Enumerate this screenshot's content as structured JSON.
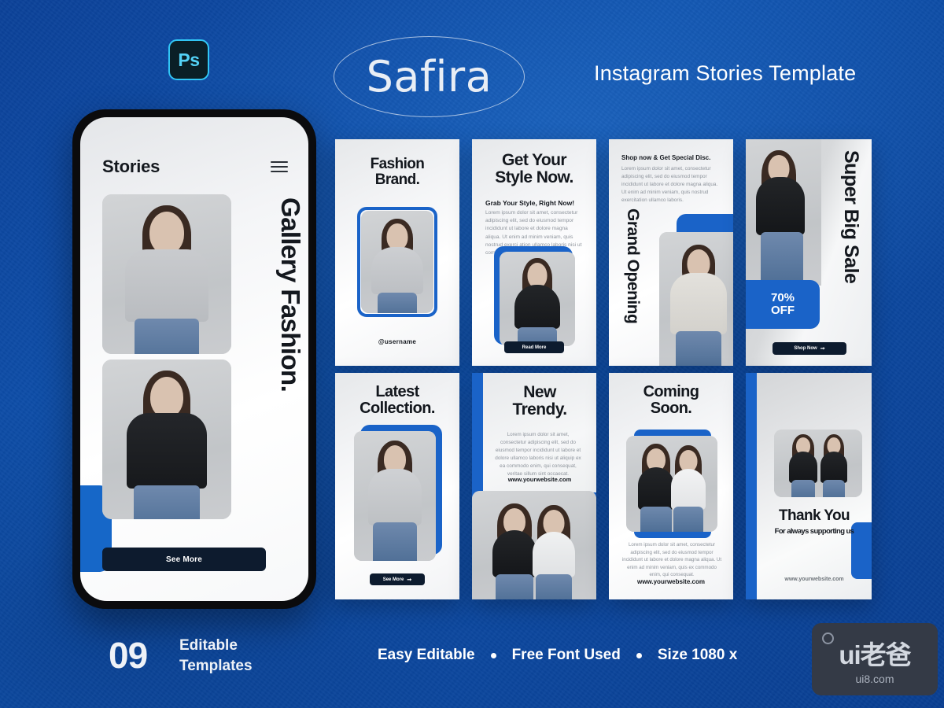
{
  "header": {
    "ps_badge": "Ps",
    "logo": "Safira",
    "tagline": "Instagram Stories Template"
  },
  "phone": {
    "title": "Stories",
    "menu_icon": "hamburger-icon",
    "vertical_title": "Gallery Fashion.",
    "button": "See More"
  },
  "cards": [
    {
      "id": "fashion-brand",
      "title": "Fashion\nBrand.",
      "username": "@username"
    },
    {
      "id": "get-your-style",
      "title": "Get Your\nStyle Now.",
      "subtitle": "Grab Your Style, Right Now!",
      "body": "Lorem ipsum dolor sit amet, consectetur adipiscing elit, sed do eiusmod tempor incididunt ut labore et dolore magna aliqua. Ut enim ad minim veniam, quis nostrud exerci ation ullamco laboris nisi ut commodo.",
      "button": "Read More"
    },
    {
      "id": "grand-opening",
      "heading": "Shop now & Get Special Disc.",
      "body": "Lorem ipsum dolor sit amet, consectetur adipiscing elit, sed do eiusmod tempor incididunt ut labore et dolore magna aliqua. Ut enim ad minim veniam, quis nostrud exercitation ullamco laboris.",
      "vertical_title": "Grand Opening"
    },
    {
      "id": "super-big-sale",
      "vertical_title": "Super Big Sale",
      "discount_value": "70%",
      "discount_label": "OFF",
      "button": "Shop Now"
    },
    {
      "id": "latest-collection",
      "title": "Latest\nCollection.",
      "button": "See More"
    },
    {
      "id": "new-trendy",
      "title": "New\nTrendy.",
      "body": "Lorem ipsum dolor sit amet, consectetur adipiscing elit, sed do eiusmod tempor incididunt ut labore et dolore ullamco laboris nisi ut aliquip ex ea commodo enim, qui consequat, veritae sillum sint occaecat.",
      "website": "www.yourwebsite.com"
    },
    {
      "id": "coming-soon",
      "title": "Coming\nSoon.",
      "body": "Lorem ipsum dolor sit amet, consectetur adipiscing elit, sed do eiusmod tempor incididunt ut labore et dolore magna aliqua. Ut enim ad minim veniam, quis ex commodo enim, qui consequat.",
      "website": "www.yourwebsite.com"
    },
    {
      "id": "thank-you",
      "title": "Thank You",
      "subtitle": "For always supporting us",
      "website": "www.yourwebsite.com"
    }
  ],
  "footer": {
    "count": "09",
    "count_label_line1": "Editable",
    "count_label_line2": "Templates",
    "features": [
      "Easy Editable",
      "Free Font Used",
      "Size 1080 x"
    ]
  },
  "watermark": {
    "main": "ui老爸",
    "sub": "ui8.com"
  },
  "colors": {
    "background_blue": "#0e4ea8",
    "accent_blue": "#1a63c8",
    "dark_button": "#0d1b2e",
    "card_light": "#f3f4f6"
  }
}
